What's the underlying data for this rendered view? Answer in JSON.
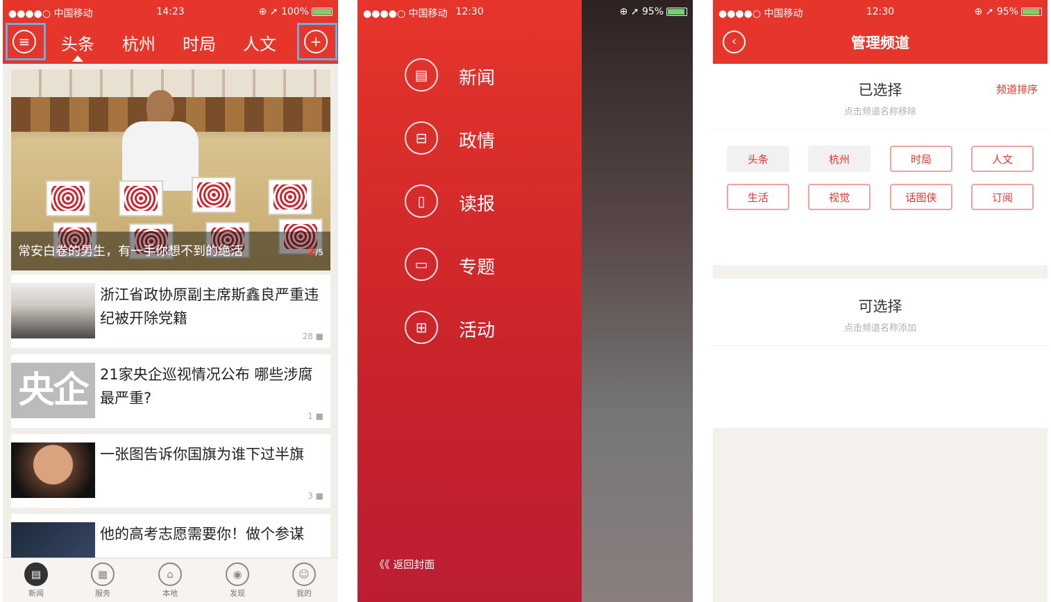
{
  "status1": {
    "carrier": "●●●●○ 中国移动 ",
    "time": "14:23",
    "battery": "⊕ ➚ 100%"
  },
  "status2": {
    "carrier": "●●●●○ 中国移动 ",
    "time": "12:30",
    "battery": "⊕ ➚ 95%"
  },
  "status3": {
    "carrier": "●●●●○ 中国移动 ",
    "time": "12:30",
    "battery": "⊕ ➚ 95%"
  },
  "news": {
    "tabs": [
      "头条",
      "杭州",
      "时局",
      "人文"
    ],
    "hero": {
      "caption": "常安白卷的男生，有一手你想不到的绝活",
      "page": "2",
      "total": "/5"
    },
    "articles": [
      {
        "title": "浙江省政协原副主席斯鑫良严重违纪被开除党籍",
        "comments": "28 ■"
      },
      {
        "title": "21家央企巡视情况公布 哪些涉腐最严重?",
        "comments": "1 ■"
      },
      {
        "title": "一张图告诉你国旗为谁下过半旗",
        "comments": "3 ■"
      },
      {
        "title": "他的高考志愿需要你！做个参谋",
        "comments": ""
      }
    ],
    "thumb_text": {
      "a2": "央企"
    },
    "tabbar": [
      "新闻",
      "服务",
      "本地",
      "发现",
      "我的"
    ]
  },
  "menu": {
    "items": [
      "新闻",
      "政情",
      "读报",
      "专题",
      "活动"
    ],
    "back": "《《 返回封面"
  },
  "manage": {
    "title": "管理频道",
    "selected_title": "已选择",
    "selected_hint": "点击频道名称移除",
    "sort_label": "频道排序",
    "selected": [
      "头条",
      "杭州",
      "时局",
      "人文",
      "生活",
      "视觉",
      "话图侠",
      "订阅"
    ],
    "available_title": "可选择",
    "available_hint": "点击频道名称添加"
  },
  "colors": {
    "brand": "#e6352b",
    "highlight": "#6aaee0"
  }
}
